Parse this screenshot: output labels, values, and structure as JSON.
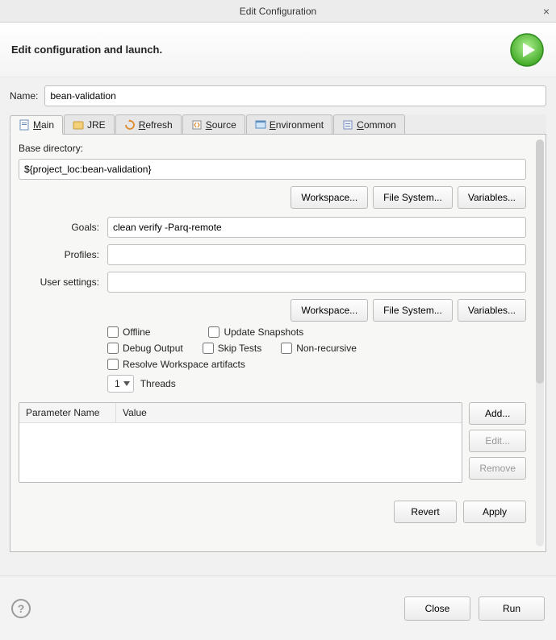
{
  "dialog": {
    "title": "Edit Configuration"
  },
  "header": {
    "title": "Edit configuration and launch."
  },
  "name": {
    "label": "Name:",
    "value": "bean-validation"
  },
  "tabs": {
    "main": "Main",
    "jre": "JRE",
    "refresh": "Refresh",
    "source": "Source",
    "environment": "Environment",
    "common": "Common"
  },
  "baseDir": {
    "label": "Base directory:",
    "value": "${project_loc:bean-validation}",
    "workspace": "Workspace...",
    "filesystem": "File System...",
    "variables": "Variables..."
  },
  "goals": {
    "label": "Goals:",
    "value": "clean verify -Parq-remote"
  },
  "profiles": {
    "label": "Profiles:",
    "value": ""
  },
  "userSettings": {
    "label": "User settings:",
    "value": "",
    "workspace": "Workspace...",
    "filesystem": "File System...",
    "variables": "Variables..."
  },
  "checks": {
    "offline": "Offline",
    "updateSnapshots": "Update Snapshots",
    "debugOutput": "Debug Output",
    "skipTests": "Skip Tests",
    "nonRecursive": "Non-recursive",
    "resolveWorkspace": "Resolve Workspace artifacts"
  },
  "threads": {
    "value": "1",
    "label": "Threads"
  },
  "params": {
    "colName": "Parameter Name",
    "colValue": "Value",
    "add": "Add...",
    "edit": "Edit...",
    "remove": "Remove"
  },
  "actions": {
    "revert": "Revert",
    "apply": "Apply"
  },
  "footer": {
    "close": "Close",
    "run": "Run"
  }
}
